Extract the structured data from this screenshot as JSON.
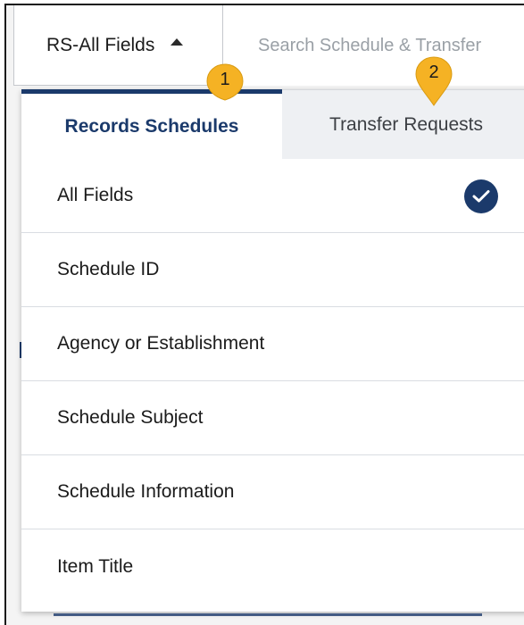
{
  "filter_button": {
    "label": "RS-All Fields"
  },
  "search": {
    "placeholder": "Search Schedule & Transfer"
  },
  "tabs": [
    {
      "label": "Records Schedules",
      "active": true
    },
    {
      "label": "Transfer Requests",
      "active": false
    }
  ],
  "dropdown_items": [
    {
      "label": "All Fields",
      "selected": true
    },
    {
      "label": "Schedule ID",
      "selected": false
    },
    {
      "label": "Agency or Establishment",
      "selected": false
    },
    {
      "label": "Schedule Subject",
      "selected": false
    },
    {
      "label": "Schedule Information",
      "selected": false
    },
    {
      "label": "Item Title",
      "selected": false
    }
  ],
  "callouts": [
    {
      "number": "1"
    },
    {
      "number": "2"
    }
  ],
  "colors": {
    "accent": "#1b3a6b",
    "callout": "#f5b224"
  },
  "icons": {
    "caret": "caret-up-icon",
    "check": "check-circle-icon",
    "callout": "callout-marker-icon"
  }
}
